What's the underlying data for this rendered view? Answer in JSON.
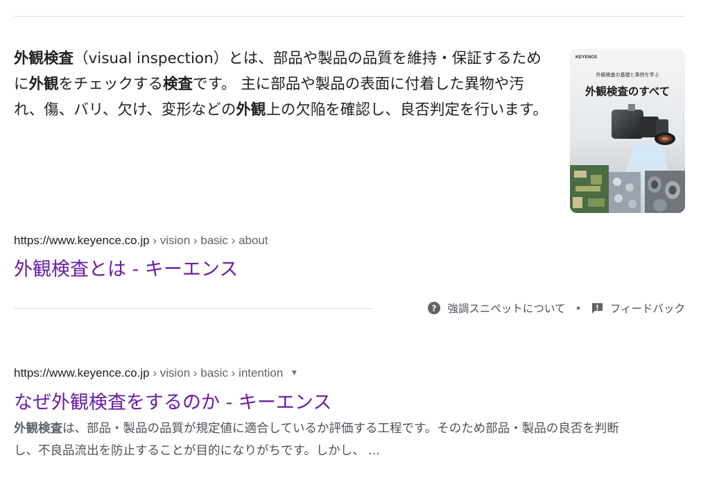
{
  "featured_snippet": {
    "text_segments": [
      {
        "t": "外観検査",
        "b": true
      },
      {
        "t": "（visual inspection）とは、部品や製品の品質を維持・保証するために",
        "b": false
      },
      {
        "t": "外観",
        "b": true
      },
      {
        "t": "をチェックする",
        "b": false
      },
      {
        "t": "検査",
        "b": true
      },
      {
        "t": "です。 主に部品や製品の表面に付着した異物や汚れ、傷、バリ、欠け、変形などの",
        "b": false
      },
      {
        "t": "外観",
        "b": true
      },
      {
        "t": "上の欠陥を確認し、良否判定を行います。",
        "b": false
      }
    ],
    "thumbnail": {
      "brand": "KEYENCE",
      "caption": "外観検査の基礎と事例を学ぶ",
      "headline": "外観検査のすべて"
    },
    "url": {
      "domain": "https://www.keyence.co.jp",
      "path": " › vision › basic › about"
    },
    "title": "外観検査とは - キーエンス",
    "footer": {
      "about_label": "強調スニペットについて",
      "separator": "•",
      "feedback_label": "フィードバック"
    }
  },
  "result": {
    "url": {
      "domain": "https://www.keyence.co.jp",
      "path": " › vision › basic › intention",
      "caret": "▼"
    },
    "title": "なぜ外観検査をするのか - キーエンス",
    "snippet_segments": [
      {
        "t": "外観検査",
        "b": true
      },
      {
        "t": "は、部品・製品の品質が規定値に適合しているか評価する工程です。そのため部品・製品の良否を判断し、不良品流出を防止することが目的になりがちです。しかし、 ...",
        "b": false
      }
    ]
  },
  "colors": {
    "link": "#681da8",
    "text": "#202124",
    "muted": "#4d5156",
    "divider": "#dadce0"
  },
  "icons": {
    "about": "help-circle-icon",
    "feedback": "feedback-icon",
    "menu": "caret-down-icon"
  }
}
